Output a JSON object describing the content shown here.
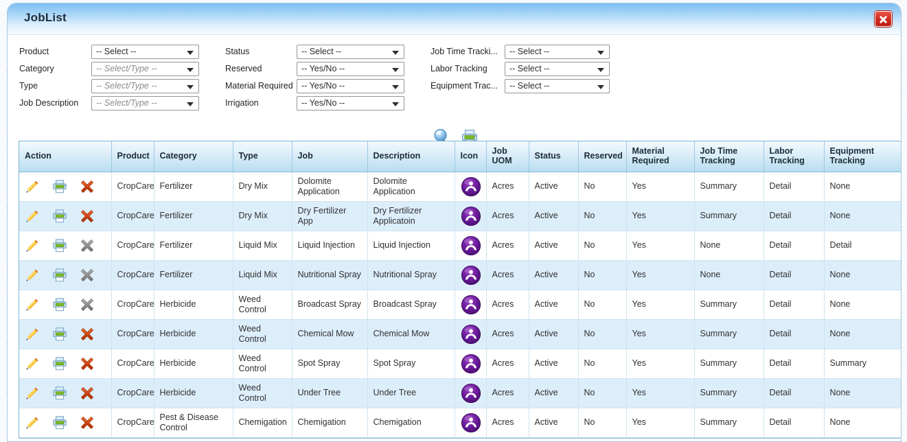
{
  "window": {
    "title": "JobList",
    "close_label": "Close"
  },
  "filters": {
    "column1": [
      {
        "label": "Product",
        "value": "-- Select --",
        "placeholder": false
      },
      {
        "label": "Category",
        "value": "-- Select/Type --",
        "placeholder": true
      },
      {
        "label": "Type",
        "value": "-- Select/Type --",
        "placeholder": true
      },
      {
        "label": "Job Description",
        "value": "-- Select/Type --",
        "placeholder": true
      }
    ],
    "column2": [
      {
        "label": "Status",
        "value": "-- Select --",
        "placeholder": false
      },
      {
        "label": "Reserved",
        "value": "-- Yes/No --",
        "placeholder": false
      },
      {
        "label": "Material Required",
        "value": "-- Yes/No --",
        "placeholder": false
      },
      {
        "label": "Irrigation",
        "value": "-- Yes/No --",
        "placeholder": false
      }
    ],
    "column3": [
      {
        "label": "Job Time Tracki...",
        "value": "-- Select --",
        "placeholder": false
      },
      {
        "label": "Labor Tracking",
        "value": "-- Select --",
        "placeholder": false
      },
      {
        "label": "Equipment Trac...",
        "value": "-- Select --",
        "placeholder": false
      }
    ]
  },
  "toolbar": {
    "search_icon": "magnifier-icon",
    "print_icon": "printer-icon",
    "add_icon": "green-plus-icon"
  },
  "grid": {
    "columns": [
      "Action",
      "Product",
      "Category",
      "Type",
      "Job",
      "Description",
      "Icon",
      "Job UOM",
      "Status",
      "Reserved",
      "Material Required",
      "Job Time Tracking",
      "Labor Tracking",
      "Equipment Tracking"
    ],
    "row_actions": {
      "edit": "edit-pencil-icon",
      "print": "row-print-icon",
      "delete": "delete-x-icon"
    },
    "rows": [
      {
        "product": "CropCare",
        "category": "Fertilizer",
        "type": "Dry Mix",
        "job": "Dolomite Application",
        "description": "Dolomite Application",
        "icon": "worker-badge-icon",
        "uom": "Acres",
        "status": "Active",
        "reserved": "No",
        "material": "Yes",
        "job_time": "Summary",
        "labor": "Detail",
        "equipment": "None",
        "delete_enabled": true
      },
      {
        "product": "CropCare",
        "category": "Fertilizer",
        "type": "Dry Mix",
        "job": "Dry Fertilizer App",
        "description": "Dry Fertilizer Applicatoin",
        "icon": "worker-badge-icon",
        "uom": "Acres",
        "status": "Active",
        "reserved": "No",
        "material": "Yes",
        "job_time": "Summary",
        "labor": "Detail",
        "equipment": "None",
        "delete_enabled": true
      },
      {
        "product": "CropCare",
        "category": "Fertilizer",
        "type": "Liquid Mix",
        "job": "Liquid Injection",
        "description": "Liquid Injection",
        "icon": "worker-badge-icon",
        "uom": "Acres",
        "status": "Active",
        "reserved": "No",
        "material": "Yes",
        "job_time": "None",
        "labor": "Detail",
        "equipment": "Detail",
        "delete_enabled": false
      },
      {
        "product": "CropCare",
        "category": "Fertilizer",
        "type": "Liquid Mix",
        "job": "Nutritional Spray",
        "description": "Nutritional Spray",
        "icon": "worker-badge-icon",
        "uom": "Acres",
        "status": "Active",
        "reserved": "No",
        "material": "Yes",
        "job_time": "None",
        "labor": "Detail",
        "equipment": "None",
        "delete_enabled": false
      },
      {
        "product": "CropCare",
        "category": "Herbicide",
        "type": "Weed Control",
        "job": "Broadcast Spray",
        "description": "Broadcast Spray",
        "icon": "worker-badge-icon",
        "uom": "Acres",
        "status": "Active",
        "reserved": "No",
        "material": "Yes",
        "job_time": "Summary",
        "labor": "Detail",
        "equipment": "None",
        "delete_enabled": false
      },
      {
        "product": "CropCare",
        "category": "Herbicide",
        "type": "Weed Control",
        "job": "Chemical Mow",
        "description": "Chemical Mow",
        "icon": "worker-badge-icon",
        "uom": "Acres",
        "status": "Active",
        "reserved": "No",
        "material": "Yes",
        "job_time": "Summary",
        "labor": "Detail",
        "equipment": "None",
        "delete_enabled": true
      },
      {
        "product": "CropCare",
        "category": "Herbicide",
        "type": "Weed Control",
        "job": "Spot Spray",
        "description": "Spot Spray",
        "icon": "worker-badge-icon",
        "uom": "Acres",
        "status": "Active",
        "reserved": "No",
        "material": "Yes",
        "job_time": "Summary",
        "labor": "Detail",
        "equipment": "Summary",
        "delete_enabled": true
      },
      {
        "product": "CropCare",
        "category": "Herbicide",
        "type": "Weed Control",
        "job": "Under Tree",
        "description": "Under Tree",
        "icon": "worker-badge-icon",
        "uom": "Acres",
        "status": "Active",
        "reserved": "No",
        "material": "Yes",
        "job_time": "Summary",
        "labor": "Detail",
        "equipment": "None",
        "delete_enabled": true
      },
      {
        "product": "CropCare",
        "category": "Pest & Disease Control",
        "type": "Chemigation",
        "job": "Chemigation",
        "description": "Chemigation",
        "icon": "worker-badge-icon",
        "uom": "Acres",
        "status": "Active",
        "reserved": "No",
        "material": "Yes",
        "job_time": "Summary",
        "labor": "Detail",
        "equipment": "None",
        "delete_enabled": true
      }
    ]
  },
  "colors": {
    "title_blue": "#7cbdf2",
    "header_blue": "#b9ddf0",
    "alt_row": "#ddeefb",
    "grid_border": "#7fb4d4",
    "close_red": "#d22f22",
    "icon_purple": "#6a1b9a",
    "add_green": "#8cc63f"
  }
}
